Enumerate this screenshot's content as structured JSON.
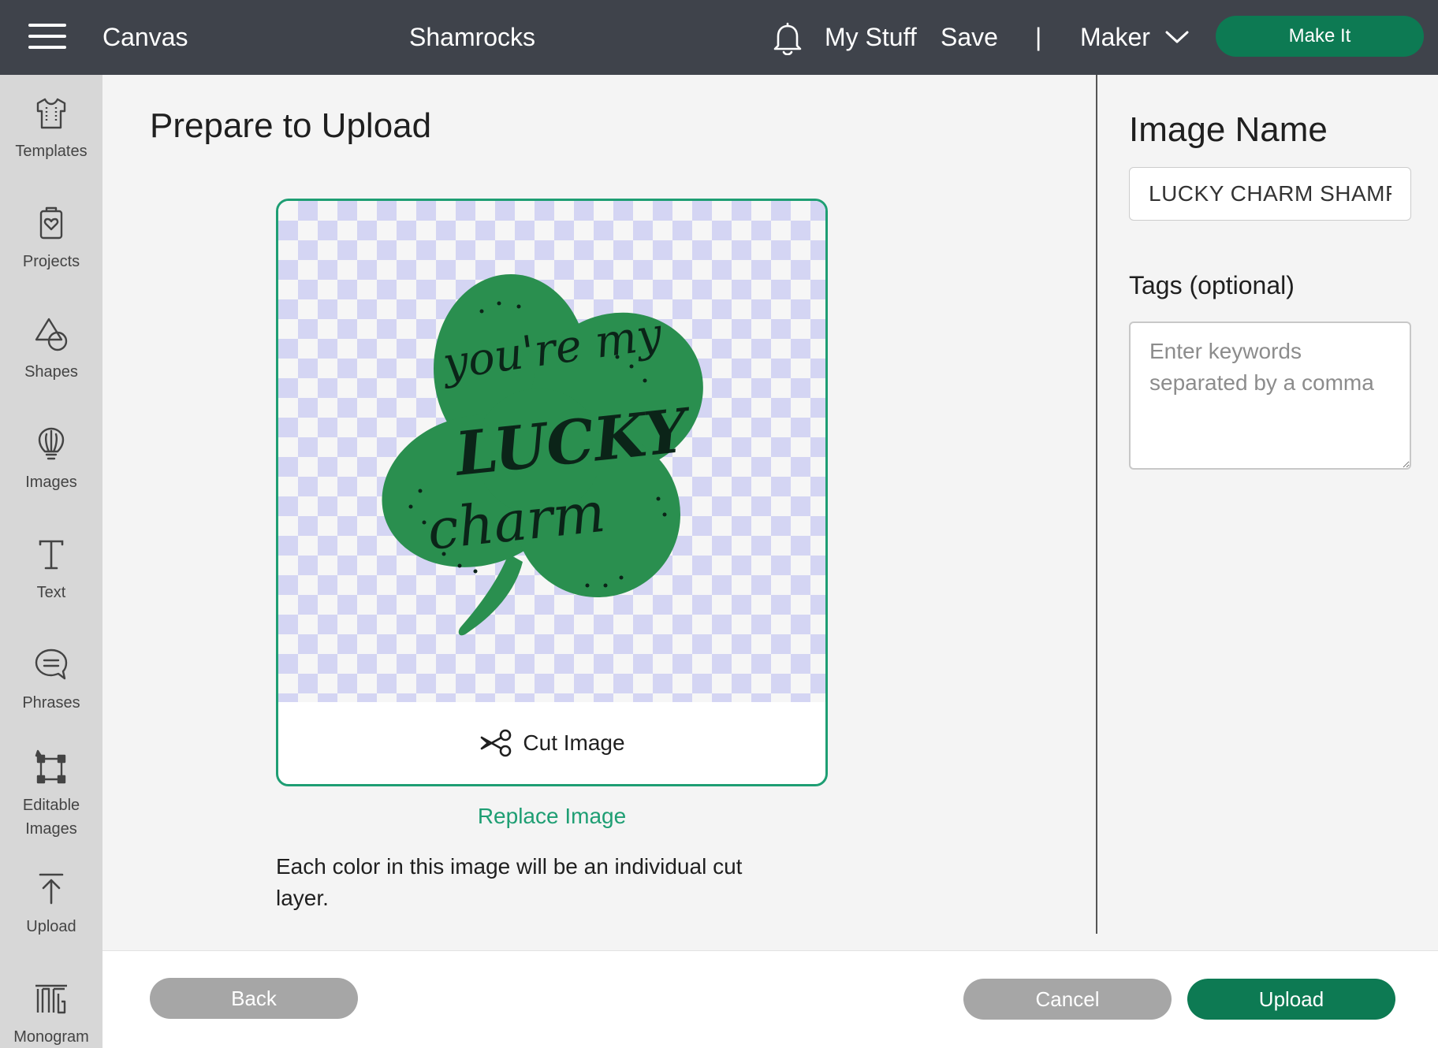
{
  "header": {
    "app_label": "Canvas",
    "project_name": "Shamrocks",
    "my_stuff": "My Stuff",
    "save": "Save",
    "separator": "|",
    "machine": "Maker",
    "make_it": "Make It"
  },
  "sidebar": {
    "items": [
      {
        "label": "Templates",
        "icon": "tshirt-icon"
      },
      {
        "label": "Projects",
        "icon": "projects-icon"
      },
      {
        "label": "Shapes",
        "icon": "shapes-icon"
      },
      {
        "label": "Images",
        "icon": "lightbulb-icon"
      },
      {
        "label": "Text",
        "icon": "text-icon"
      },
      {
        "label": "Phrases",
        "icon": "speech-bubble-icon"
      },
      {
        "label": "Editable Images",
        "icon": "editable-image-icon"
      },
      {
        "label": "Upload",
        "icon": "upload-icon"
      },
      {
        "label": "Monogram",
        "icon": "monogram-icon"
      }
    ]
  },
  "main": {
    "title": "Prepare to Upload",
    "preview": {
      "artwork_text": [
        "you're my",
        "LUCKY",
        "charm"
      ],
      "cut_label": "Cut Image"
    },
    "replace_link": "Replace Image",
    "info": "Each color in this image will be an individual cut layer."
  },
  "right_panel": {
    "image_name_label": "Image Name",
    "image_name_value": "LUCKY CHARM SHAMROCK",
    "tags_label": "Tags (optional)",
    "tags_placeholder": "Enter keywords separated by a comma"
  },
  "footer": {
    "back": "Back",
    "cancel": "Cancel",
    "upload": "Upload"
  },
  "colors": {
    "header_bg": "#3f434b",
    "primary_green": "#0d7a53",
    "accent_green": "#1e9e73",
    "disabled_gray": "#a6a6a6",
    "shamrock_green": "#2a8f4f"
  }
}
